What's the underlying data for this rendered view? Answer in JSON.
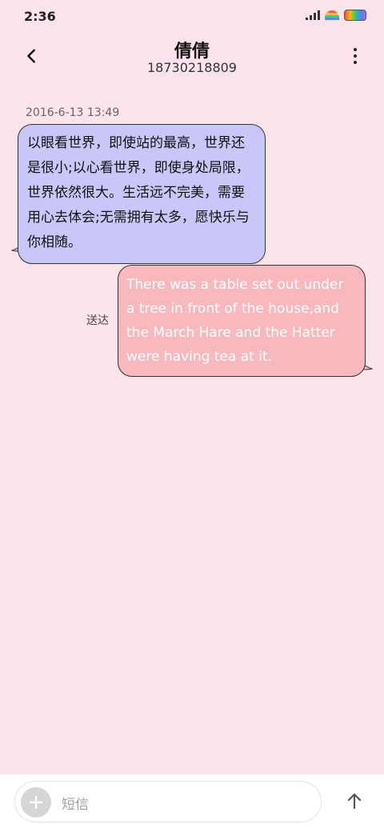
{
  "status_bar": {
    "time": "2:36",
    "icons": [
      "signal-icon",
      "rainbow-icon",
      "battery-icon"
    ]
  },
  "header": {
    "contact_name": "倩倩",
    "contact_number": "18730218809",
    "back_icon": "chevron-left-icon",
    "more_icon": "more-vertical-icon"
  },
  "conversation": {
    "timestamp": "2016-6-13 13:49",
    "incoming_message": "以眼看世界，即使站的最高，世界还是很小;以心看世界，即使身处局限，世界依然很大。生活远不完美，需要用心去体会;无需拥有太多，愿快乐与你相随。",
    "outgoing_message": "There was a table set out under a tree in front of the house,and the March Hare and the Hatter were having tea at it.",
    "outgoing_status": "送达"
  },
  "composer": {
    "placeholder": "短信",
    "add_icon": "plus-icon",
    "send_icon": "arrow-up-icon"
  },
  "colors": {
    "background": "#fde3ea",
    "incoming_bubble": "#c8c7f7",
    "outgoing_bubble": "#f8b9be"
  }
}
